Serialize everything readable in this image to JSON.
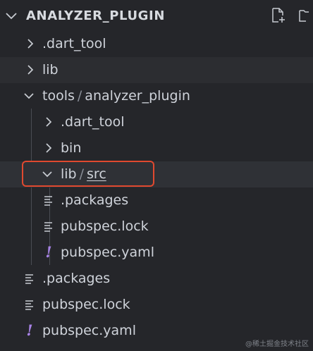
{
  "explorer": {
    "title": "ANALYZER_PLUGIN",
    "actions": [
      "new-file-icon",
      "new-folder-icon"
    ]
  },
  "tree": [
    {
      "name": ".dart_tool",
      "type": "folder",
      "expanded": false
    },
    {
      "name": "lib",
      "type": "folder",
      "expanded": false
    },
    {
      "name": "tools",
      "path_tail": "analyzer_plugin",
      "type": "folder",
      "expanded": true
    },
    {
      "name": ".dart_tool",
      "type": "folder",
      "expanded": false
    },
    {
      "name": "bin",
      "type": "folder",
      "expanded": false
    },
    {
      "name": "lib",
      "path_tail": "src",
      "type": "folder",
      "expanded": true
    },
    {
      "name": ".packages",
      "type": "file",
      "icon": "lines"
    },
    {
      "name": "pubspec.lock",
      "type": "file",
      "icon": "lines"
    },
    {
      "name": "pubspec.yaml",
      "type": "file",
      "icon": "exclamation"
    },
    {
      "name": ".packages",
      "type": "file",
      "icon": "lines"
    },
    {
      "name": "pubspec.lock",
      "type": "file",
      "icon": "lines"
    },
    {
      "name": "pubspec.yaml",
      "type": "file",
      "icon": "exclamation"
    }
  ],
  "separator": "/",
  "yaml_icon_glyph": "!",
  "watermark": "@稀土掘金技术社区",
  "colors": {
    "background": "#25262a",
    "highlight": "#e0492f",
    "yaml_icon": "#a883e6"
  }
}
